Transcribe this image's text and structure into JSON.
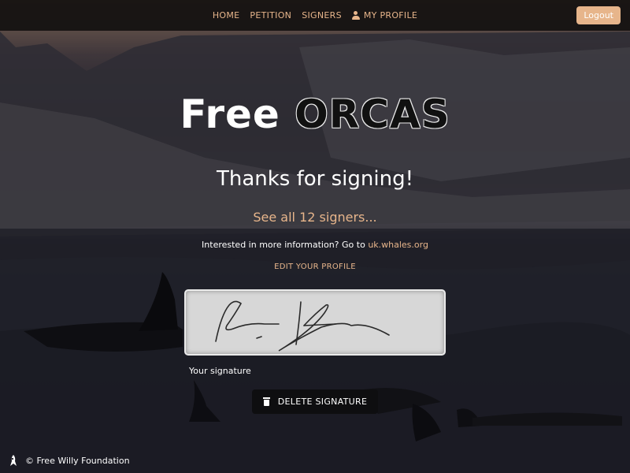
{
  "nav": {
    "links": [
      {
        "label": "HOME"
      },
      {
        "label": "PETITION"
      },
      {
        "label": "SIGNERS"
      },
      {
        "label": "MY PROFILE",
        "icon": "user-icon"
      }
    ],
    "logout_label": "Logout"
  },
  "hero": {
    "title_part1": "Free",
    "title_part2": "ORCAS",
    "thanks": "Thanks for signing!",
    "see_all": "See all 12 signers...",
    "info_text": "Interested in more information? Go to",
    "info_link": "uk.whales.org",
    "edit_profile": "EDIT YOUR PROFILE"
  },
  "signature": {
    "label": "Your signature",
    "delete_label": "DELETE SIGNATURE",
    "delete_icon": "trash-icon"
  },
  "footer": {
    "text": "© Free Willy Foundation",
    "icon": "orca-icon"
  },
  "colors": {
    "accent": "#e7b58b",
    "navbar": "#121010",
    "button_dark": "#0e0e10"
  }
}
